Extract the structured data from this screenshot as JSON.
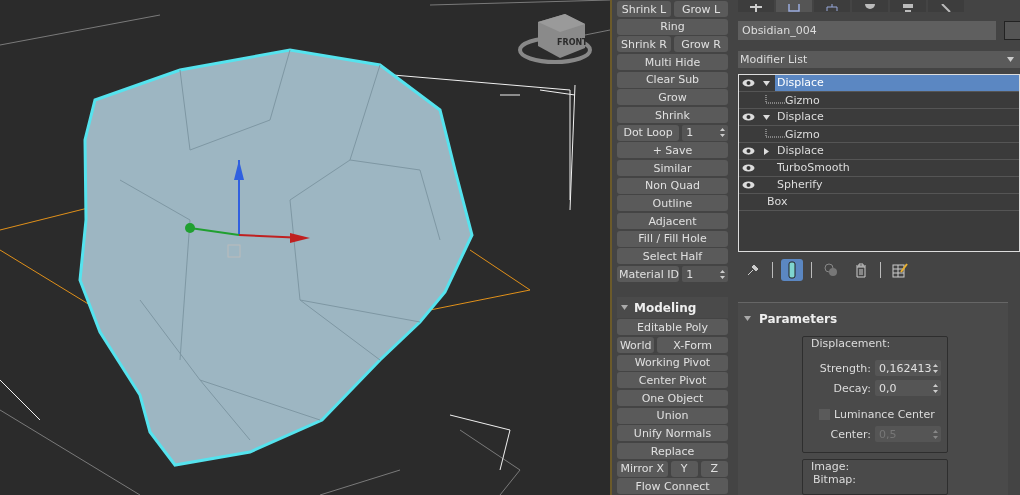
{
  "viewport": {
    "viewcube_label": "FRONT"
  },
  "ribbon": {
    "rows": [
      {
        "buttons": [
          {
            "kind": "button",
            "label": "Shrink L"
          },
          {
            "kind": "button",
            "label": "Grow L"
          }
        ]
      },
      {
        "buttons": [
          {
            "kind": "button",
            "label": "Ring"
          }
        ]
      },
      {
        "buttons": [
          {
            "kind": "button",
            "label": "Shrink R"
          },
          {
            "kind": "button",
            "label": "Grow R"
          }
        ]
      },
      {
        "buttons": [
          {
            "kind": "button",
            "label": "Multi Hide"
          }
        ]
      },
      {
        "buttons": [
          {
            "kind": "button",
            "label": "Clear Sub"
          }
        ]
      },
      {
        "buttons": [
          {
            "kind": "button",
            "label": "Grow"
          }
        ]
      },
      {
        "buttons": [
          {
            "kind": "button",
            "label": "Shrink"
          }
        ]
      },
      {
        "buttons": [
          {
            "kind": "spinner",
            "label": "Dot Loop",
            "value": "1"
          }
        ]
      },
      {
        "buttons": [
          {
            "kind": "button",
            "label": "+ Save"
          }
        ]
      },
      {
        "buttons": [
          {
            "kind": "button",
            "label": "Similar"
          }
        ]
      },
      {
        "buttons": [
          {
            "kind": "button",
            "label": "Non Quad"
          }
        ]
      },
      {
        "buttons": [
          {
            "kind": "button",
            "label": "Outline"
          }
        ]
      },
      {
        "buttons": [
          {
            "kind": "button",
            "label": "Adjacent"
          }
        ]
      },
      {
        "buttons": [
          {
            "kind": "button",
            "label": "Fill / Fill Hole"
          }
        ]
      },
      {
        "buttons": [
          {
            "kind": "button",
            "label": "Select Half"
          }
        ]
      },
      {
        "buttons": [
          {
            "kind": "spinner",
            "label": "Material ID",
            "value": "1"
          }
        ]
      }
    ],
    "section": {
      "title": "Modeling",
      "expanded": true,
      "rows": [
        {
          "buttons": [
            {
              "kind": "button",
              "label": "Editable Poly"
            }
          ]
        },
        {
          "buttons": [
            {
              "kind": "button",
              "label": "World"
            },
            {
              "kind": "button",
              "label": "X-Form"
            }
          ]
        },
        {
          "buttons": [
            {
              "kind": "button",
              "label": "Working Pivot"
            }
          ]
        },
        {
          "buttons": [
            {
              "kind": "button",
              "label": "Center Pivot"
            }
          ]
        },
        {
          "buttons": [
            {
              "kind": "button",
              "label": "One Object"
            }
          ]
        },
        {
          "buttons": [
            {
              "kind": "button",
              "label": "Union"
            }
          ]
        },
        {
          "buttons": [
            {
              "kind": "button",
              "label": "Unify Normals"
            }
          ]
        },
        {
          "buttons": [
            {
              "kind": "button",
              "label": "Replace"
            }
          ]
        },
        {
          "buttons": [
            {
              "kind": "button",
              "label": "Mirror X"
            },
            {
              "kind": "button",
              "label": "Y"
            },
            {
              "kind": "button",
              "label": "Z"
            }
          ]
        },
        {
          "buttons": [
            {
              "kind": "button",
              "label": "Flow Connect"
            }
          ]
        }
      ]
    }
  },
  "command_panel": {
    "tabs": [
      {
        "kind": "create",
        "selected": false
      },
      {
        "kind": "modify",
        "selected": true
      },
      {
        "kind": "hierarchy",
        "selected": false
      },
      {
        "kind": "motion",
        "selected": false
      },
      {
        "kind": "display",
        "selected": false
      },
      {
        "kind": "utilities",
        "selected": false
      }
    ],
    "object_name": "Obsidian_004",
    "modifier_list": "Modifier List",
    "stack": [
      {
        "kind": "modifier",
        "label": "Displace",
        "expanded": true,
        "selected": true,
        "children": [
          {
            "label": "Gizmo"
          }
        ]
      },
      {
        "kind": "modifier",
        "label": "Displace",
        "expanded": true,
        "selected": false,
        "children": [
          {
            "label": "Gizmo"
          }
        ]
      },
      {
        "kind": "modifier",
        "label": "Displace",
        "expanded": false,
        "selected": false
      },
      {
        "kind": "modifier",
        "label": "TurboSmooth",
        "selected": false
      },
      {
        "kind": "modifier",
        "label": "Spherify",
        "selected": false
      },
      {
        "kind": "base",
        "label": "Box",
        "selected": false
      }
    ],
    "stack_tools": [
      {
        "kind": "pin",
        "selected": false
      },
      {
        "kind": "end-result",
        "selected": true
      },
      {
        "kind": "make-unique",
        "selected": false
      },
      {
        "kind": "remove",
        "selected": false
      },
      {
        "kind": "configure",
        "selected": false
      }
    ],
    "parameters": {
      "title": "Parameters",
      "expanded": true,
      "displacement": {
        "title": "Displacement:",
        "fields": [
          {
            "label": "Strength:",
            "value": "0,162413",
            "disabled": false
          },
          {
            "label": "Decay:",
            "value": "0,0",
            "disabled": false
          }
        ],
        "luminance": {
          "label": "Luminance Center",
          "checked": false
        },
        "center": {
          "label": "Center:",
          "value": "0,5",
          "disabled": true
        }
      },
      "image": {
        "title": "Image:",
        "bitmap": "Bitmap:"
      }
    }
  }
}
